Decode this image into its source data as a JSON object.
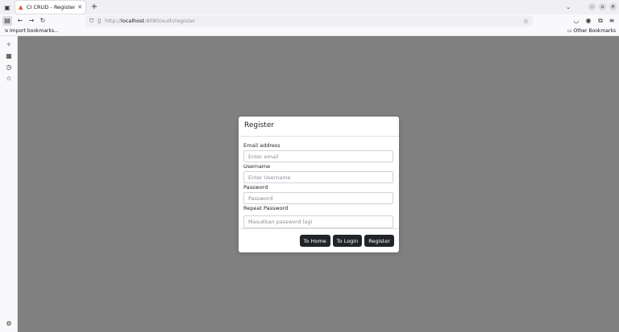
{
  "browser": {
    "tab": {
      "title": "CI CRUD - Register",
      "favicon": "flame-icon"
    },
    "url": {
      "prefix": "http://",
      "host": "localhost",
      "rest": ":8080/auth/register"
    },
    "bookmarks": {
      "import_label": "Import bookmarks...",
      "other_label": "Other Bookmarks"
    },
    "icons": [
      "sidebar-icon",
      "back-icon",
      "forward-icon",
      "reload-icon",
      "shield-icon",
      "page-icon",
      "star-icon",
      "pocket-icon",
      "account-icon",
      "extensions-icon",
      "menu-icon",
      "ai-chat-icon",
      "synced-tabs-icon",
      "history-icon",
      "bookmarks-icon",
      "settings-icon"
    ]
  },
  "modal": {
    "title": "Register",
    "email": {
      "label": "Email address",
      "placeholder": "Enter email"
    },
    "username": {
      "label": "Username",
      "placeholder": "Enter Username"
    },
    "password": {
      "label": "Password",
      "placeholder": "Password"
    },
    "repeat_password": {
      "label": "Repeat Password",
      "placeholder": "Masukkan password lagi"
    },
    "buttons": {
      "home": "To Home",
      "login": "To Login",
      "register": "Register"
    }
  },
  "colors": {
    "overlay": "#808080",
    "button": "#212529",
    "accent_favicon": "#e44d26"
  }
}
